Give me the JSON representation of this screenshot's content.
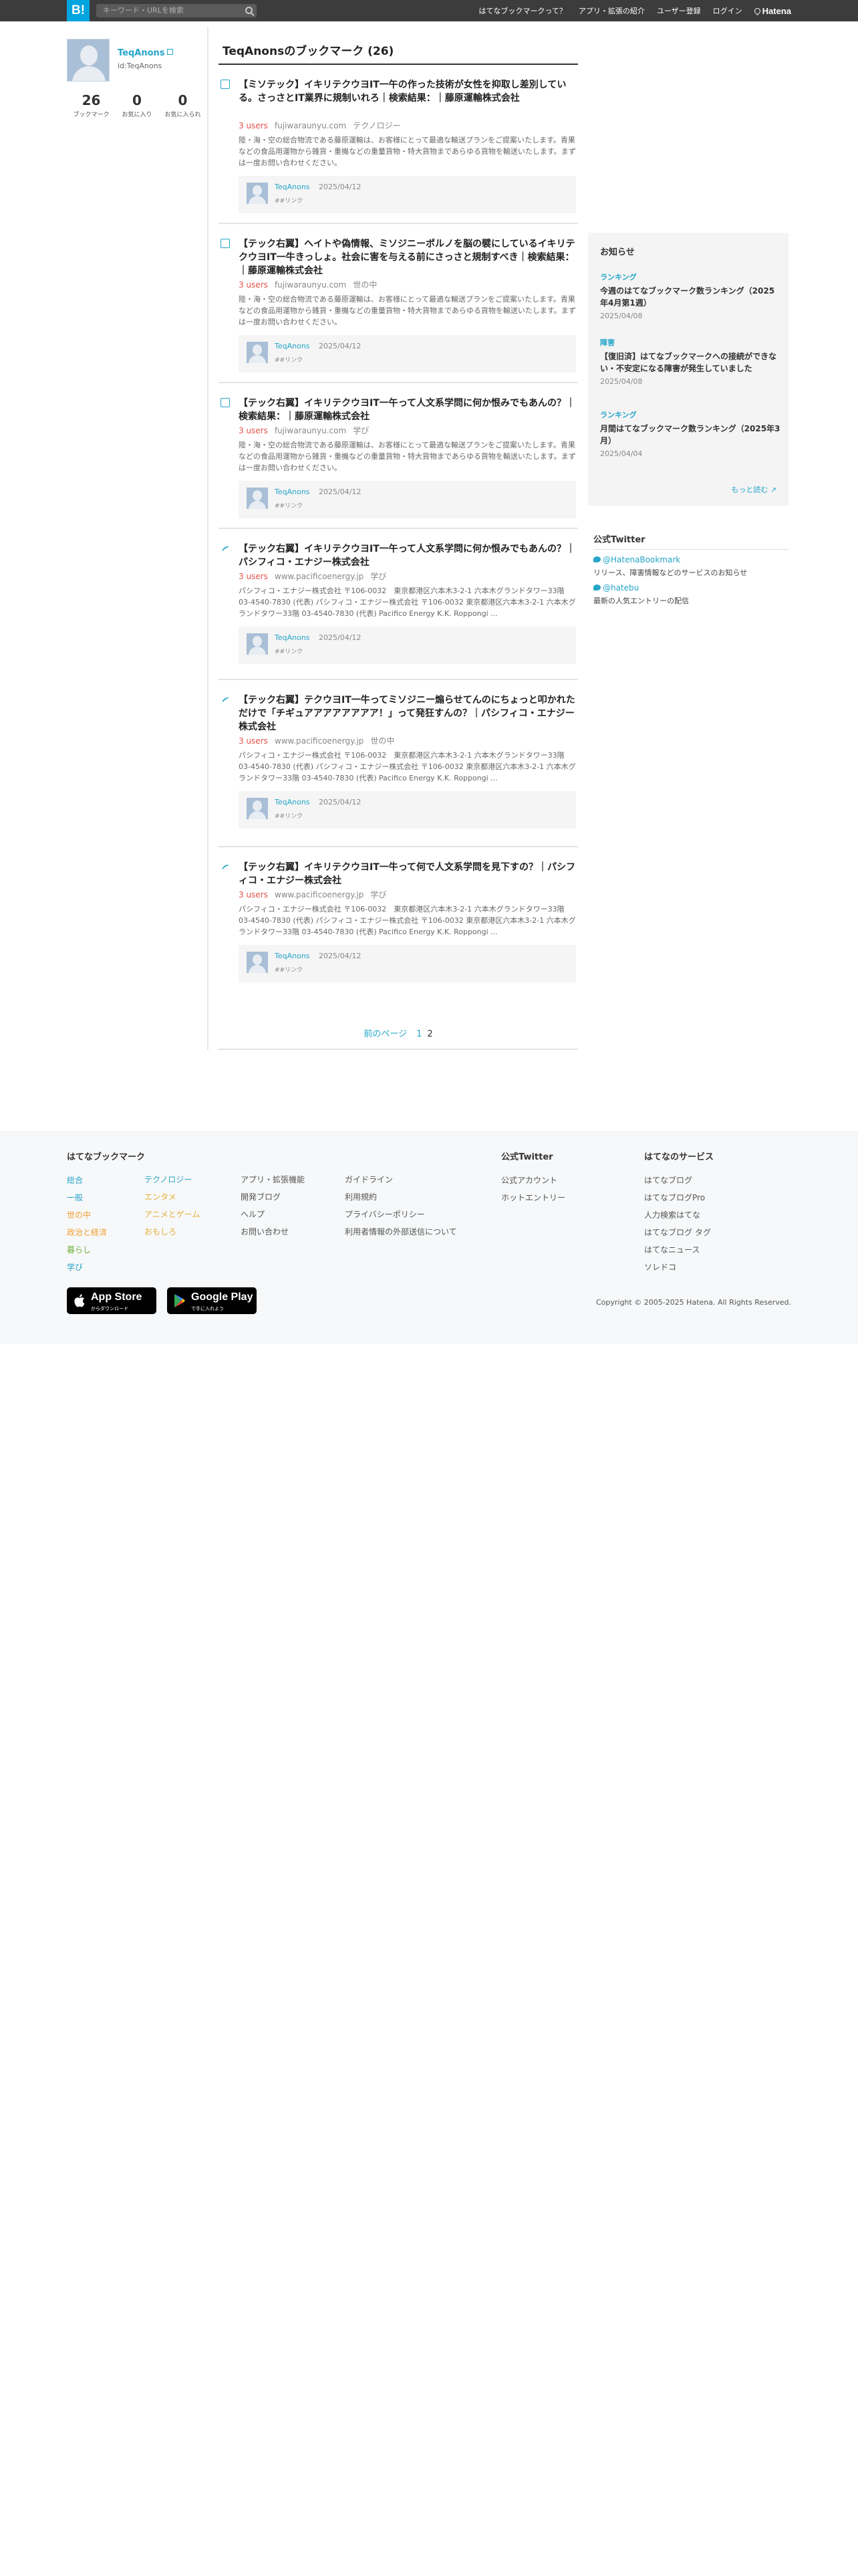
{
  "header": {
    "logo": "B!",
    "search_placeholder": "キーワード・URLを検索",
    "nav": [
      "はてなブックマークって？",
      "アプリ・拡張の紹介",
      "ユーザー登録",
      "ログイン"
    ],
    "brand": "Hatena"
  },
  "profile": {
    "name": "TeqAnons",
    "id_label": "id:TeqAnons",
    "stats": [
      {
        "value": "26",
        "label": "ブックマーク"
      },
      {
        "value": "0",
        "label": "お気に入り"
      },
      {
        "value": "0",
        "label": "お気に入られ"
      }
    ]
  },
  "main": {
    "title": "TeqAnonsのブックマーク (26)",
    "entries": [
      {
        "title": "【ミソテック】イキリテクウヨIT一午の作った技術が女性を抑取し差別している。さっさとIT業界に規制いれろ｜検索結果：｜藤原運輸株式会社",
        "users": "3 users",
        "domain": "fujiwaraunyu.com",
        "category": "テクノロジー",
        "desc": "陸・海・空の総合物流である藤原運輸は、お客様にとって最適な輸送プランをご提案いたします。青果などの食品用運物から雑貨・重機などの重量貨物・特大貨物まであらゆる貨物を輸送いたします。まずは一度お問い合わせください。",
        "user": "TeqAnons",
        "date": "2025/04/12",
        "links": "##リンク"
      },
      {
        "title": "【テック右翼】ヘイトや偽情報、ミソジニーポルノを脳の襞にしているイキリテクウヨIT一牛きっしょ。社会に害を与える前にさっさと規制すべき｜検索結果：｜藤原運輸株式会社",
        "users": "3 users",
        "domain": "fujiwaraunyu.com",
        "category": "世の中",
        "desc": "陸・海・空の総合物流である藤原運輸は、お客様にとって最適な輸送プランをご提案いたします。青果などの食品用運物から雑貨・重機などの重量貨物・特大貨物まであらゆる貨物を輸送いたします。まずは一度お問い合わせください。",
        "user": "TeqAnons",
        "date": "2025/04/12",
        "links": "##リンク"
      },
      {
        "title": "【テック右翼】イキリテクウヨIT一午って人文系学問に何か恨みでもあんの？｜検索結果：｜藤原運輸株式会社",
        "users": "3 users",
        "domain": "fujiwaraunyu.com",
        "category": "学び",
        "desc": "陸・海・空の総合物流である藤原運輸は、お客様にとって最適な輸送プランをご提案いたします。青果などの食品用運物から雑貨・重機などの重量貨物・特大貨物まであらゆる貨物を輸送いたします。まずは一度お問い合わせください。",
        "user": "TeqAnons",
        "date": "2025/04/12",
        "links": "##リンク"
      },
      {
        "title": "【テック右翼】イキリテクウヨIT一午って人文系学問に何か恨みでもあんの？｜パシフィコ・エナジー株式会社",
        "users": "3 users",
        "domain": "www.pacificoenergy.jp",
        "category": "学び",
        "desc": "パシフィコ・エナジー株式会社 〒106-0032　東京都港区六本木3-2-1 六本木グランドタワー33階 03-4540-7830 (代表) パシフィコ・エナジー株式会社 〒106-0032 東京都港区六本木3-2-1 六本木グランドタワー33階 03-4540-7830 (代表) Pacifico Energy K.K. Roppongi ...",
        "user": "TeqAnons",
        "date": "2025/04/12",
        "links": "##リンク"
      },
      {
        "title": "【テック右翼】テクウヨIT一牛ってミソジニー煽らせてんのにちょっと叩かれただけで「チギュアアアアアアアア！」って発狂すんの？｜パシフィコ・エナジー株式会社",
        "users": "3 users",
        "domain": "www.pacificoenergy.jp",
        "category": "世の中",
        "desc": "パシフィコ・エナジー株式会社 〒106-0032　東京都港区六本木3-2-1 六本木グランドタワー33階 03-4540-7830 (代表) パシフィコ・エナジー株式会社 〒106-0032 東京都港区六本木3-2-1 六本木グランドタワー33階 03-4540-7830 (代表) Pacifico Energy K.K. Roppongi ...",
        "user": "TeqAnons",
        "date": "2025/04/12",
        "links": "##リンク"
      },
      {
        "title": "【テック右翼】イキリテクウヨIT一牛って何で人文系学問を見下すの？｜パシフィコ・エナジー株式会社",
        "users": "3 users",
        "domain": "www.pacificoenergy.jp",
        "category": "学び",
        "desc": "パシフィコ・エナジー株式会社 〒106-0032　東京都港区六本木3-2-1 六本木グランドタワー33階 03-4540-7830 (代表) パシフィコ・エナジー株式会社 〒106-0032 東京都港区六本木3-2-1 六本木グランドタワー33階 03-4540-7830 (代表) Pacifico Energy K.K. Roppongi ...",
        "user": "TeqAnons",
        "date": "2025/04/12",
        "links": "##リンク"
      }
    ],
    "pager": {
      "prev": "前のページ",
      "p1": "1",
      "p2": "2"
    }
  },
  "sidebar": {
    "title": "お知らせ",
    "news": [
      {
        "cat": "ランキング",
        "title": "今週のはてなブックマーク数ランキング（2025年4月第1週）",
        "date": "2025/04/08"
      },
      {
        "cat": "障害",
        "title": "【復旧済】はてなブックマークへの接続ができない・不安定になる障害が発生していました",
        "date": "2025/04/08"
      },
      {
        "cat": "ランキング",
        "title": "月間はてなブックマーク数ランキング（2025年3月）",
        "date": "2025/04/04"
      }
    ],
    "more": "もっと読む"
  },
  "twitter": {
    "title": "公式Twitter",
    "items": [
      {
        "handle": "@HatenaBookmark",
        "desc": "リリース、障害情報などのサービスのお知らせ"
      },
      {
        "handle": "@hatebu",
        "desc": "最新の人気エントリーの配信"
      }
    ]
  },
  "footer": {
    "col1_title": "はてなブックマーク",
    "cats_a": [
      "総合",
      "一般",
      "世の中",
      "政治と経済",
      "暮らし",
      "学び"
    ],
    "cats_b": [
      "テクノロジー",
      "エンタメ",
      "アニメとゲーム",
      "おもしろ"
    ],
    "col3": [
      "アプリ・拡張機能",
      "開発ブログ",
      "ヘルプ",
      "お問い合わせ"
    ],
    "col4": [
      "ガイドライン",
      "利用規約",
      "プライバシーポリシー",
      "利用者情報の外部送信について"
    ],
    "tw_title": "公式Twitter",
    "tw_items": [
      "公式アカウント",
      "ホットエントリー"
    ],
    "svc_title": "はてなのサービス",
    "svc_items": [
      "はてなブログ",
      "はてなブログPro",
      "人力検索はてな",
      "はてなブログ タグ",
      "はてなニュース",
      "ソレドコ"
    ],
    "appstore": {
      "big": "App Store",
      "small": "からダウンロード"
    },
    "googleplay": {
      "big": "Google Play",
      "small": "で手に入れよう"
    },
    "copyright": "Copyright © 2005-2025 Hatena. All Rights Reserved."
  }
}
